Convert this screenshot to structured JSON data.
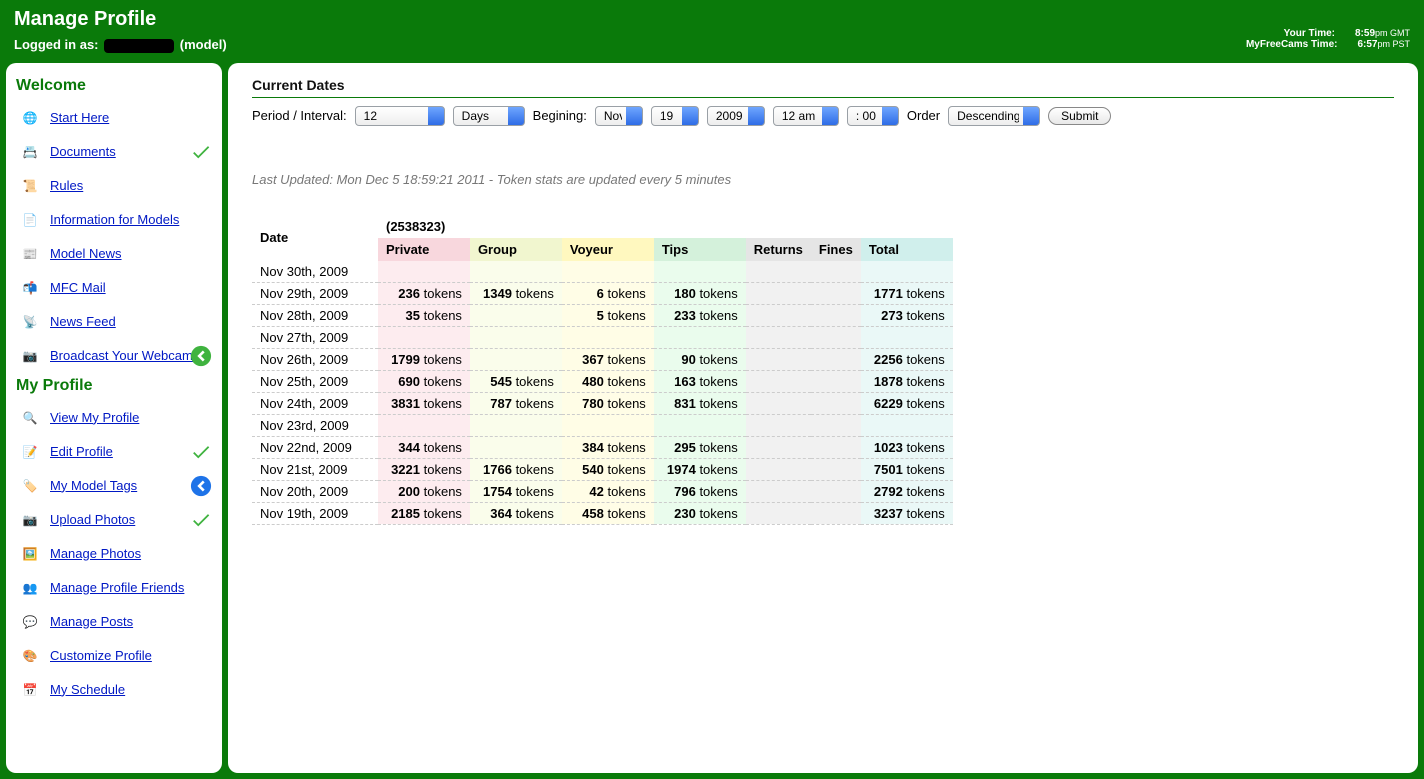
{
  "header": {
    "page_title": "Manage Profile",
    "logged_in_prefix": "Logged in as:",
    "role_suffix": "(model)",
    "your_time_label": "Your Time:",
    "your_time_value_big": "8:59",
    "your_time_value_sm": "pm GMT",
    "mfc_time_label": "MyFreeCams Time:",
    "mfc_time_value_big": "6:57",
    "mfc_time_value_sm": "pm PST"
  },
  "sidebar": {
    "welcome_title": "Welcome",
    "my_profile_title": "My Profile",
    "welcome_items": [
      {
        "label": "Start Here",
        "icon": "globe",
        "check": false,
        "arrow": false
      },
      {
        "label": "Documents",
        "icon": "documents",
        "check": true,
        "arrow": false
      },
      {
        "label": "Rules",
        "icon": "rules",
        "check": false,
        "arrow": false
      },
      {
        "label": "Information for Models",
        "icon": "info-doc",
        "check": false,
        "arrow": false
      },
      {
        "label": "Model News",
        "icon": "news",
        "check": false,
        "arrow": false
      },
      {
        "label": "MFC Mail",
        "icon": "mail",
        "check": false,
        "arrow": false
      },
      {
        "label": "News Feed",
        "icon": "feed",
        "check": false,
        "arrow": false
      },
      {
        "label": "Broadcast Your Webcam!",
        "icon": "webcam",
        "check": false,
        "arrow": "green-left"
      }
    ],
    "profile_items": [
      {
        "label": "View My Profile",
        "icon": "view",
        "check": false,
        "arrow": false
      },
      {
        "label": "Edit Profile",
        "icon": "edit",
        "check": true,
        "arrow": false
      },
      {
        "label": "My Model Tags",
        "icon": "tags",
        "check": false,
        "arrow": "blue-left"
      },
      {
        "label": "Upload Photos",
        "icon": "camera",
        "check": true,
        "arrow": false
      },
      {
        "label": "Manage Photos",
        "icon": "photo",
        "check": false,
        "arrow": false
      },
      {
        "label": "Manage Profile Friends",
        "icon": "friends",
        "check": false,
        "arrow": false
      },
      {
        "label": "Manage Posts",
        "icon": "posts",
        "check": false,
        "arrow": false
      },
      {
        "label": "Customize Profile",
        "icon": "palette",
        "check": false,
        "arrow": false
      },
      {
        "label": "My Schedule",
        "icon": "calendar",
        "check": false,
        "arrow": false
      }
    ]
  },
  "filter": {
    "section_title": "Current Dates",
    "period_label": "Period / Interval:",
    "period_value": "12",
    "unit_value": "Days",
    "beginning_label": "Begining:",
    "month_value": "Nov",
    "day_value": "19",
    "year_value": "2009",
    "hour_value": "12 am",
    "minute_value": ": 00",
    "order_label": "Order",
    "order_value": "Descending",
    "submit_label": "Submit"
  },
  "updated_line": "Last Updated: Mon Dec 5 18:59:21 2011 - Token stats are updated every 5 minutes",
  "table": {
    "account_id": "(2538323)",
    "date_header": "Date",
    "unit_word": "tokens",
    "cols": [
      "Private",
      "Group",
      "Voyeur",
      "Tips",
      "Returns",
      "Fines",
      "Total"
    ],
    "rows": [
      {
        "date": "Nov 30th, 2009",
        "private": null,
        "group": null,
        "voyeur": null,
        "tips": null,
        "returns": null,
        "fines": null,
        "total": null
      },
      {
        "date": "Nov 29th, 2009",
        "private": 236,
        "group": 1349,
        "voyeur": 6,
        "tips": 180,
        "returns": null,
        "fines": null,
        "total": 1771
      },
      {
        "date": "Nov 28th, 2009",
        "private": 35,
        "group": null,
        "voyeur": 5,
        "tips": 233,
        "returns": null,
        "fines": null,
        "total": 273
      },
      {
        "date": "Nov 27th, 2009",
        "private": null,
        "group": null,
        "voyeur": null,
        "tips": null,
        "returns": null,
        "fines": null,
        "total": null
      },
      {
        "date": "Nov 26th, 2009",
        "private": 1799,
        "group": null,
        "voyeur": 367,
        "tips": 90,
        "returns": null,
        "fines": null,
        "total": 2256
      },
      {
        "date": "Nov 25th, 2009",
        "private": 690,
        "group": 545,
        "voyeur": 480,
        "tips": 163,
        "returns": null,
        "fines": null,
        "total": 1878
      },
      {
        "date": "Nov 24th, 2009",
        "private": 3831,
        "group": 787,
        "voyeur": 780,
        "tips": 831,
        "returns": null,
        "fines": null,
        "total": 6229
      },
      {
        "date": "Nov 23rd, 2009",
        "private": null,
        "group": null,
        "voyeur": null,
        "tips": null,
        "returns": null,
        "fines": null,
        "total": null
      },
      {
        "date": "Nov 22nd, 2009",
        "private": 344,
        "group": null,
        "voyeur": 384,
        "tips": 295,
        "returns": null,
        "fines": null,
        "total": 1023
      },
      {
        "date": "Nov 21st, 2009",
        "private": 3221,
        "group": 1766,
        "voyeur": 540,
        "tips": 1974,
        "returns": null,
        "fines": null,
        "total": 7501
      },
      {
        "date": "Nov 20th, 2009",
        "private": 200,
        "group": 1754,
        "voyeur": 42,
        "tips": 796,
        "returns": null,
        "fines": null,
        "total": 2792
      },
      {
        "date": "Nov 19th, 2009",
        "private": 2185,
        "group": 364,
        "voyeur": 458,
        "tips": 230,
        "returns": null,
        "fines": null,
        "total": 3237
      }
    ]
  },
  "icons": {
    "globe": "🌐",
    "documents": "📇",
    "rules": "📜",
    "info-doc": "📄",
    "news": "📰",
    "mail": "📬",
    "feed": "📡",
    "webcam": "📷",
    "view": "🔍",
    "edit": "📝",
    "tags": "🏷️",
    "camera": "📷",
    "photo": "🖼️",
    "friends": "👥",
    "posts": "💬",
    "palette": "🎨",
    "calendar": "📅"
  }
}
